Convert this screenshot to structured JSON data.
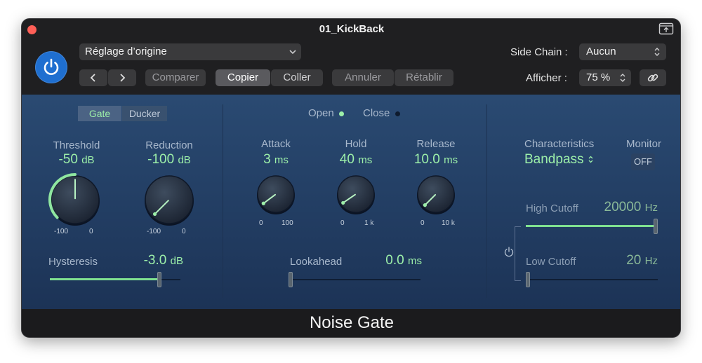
{
  "window": {
    "title": "01_KickBack"
  },
  "toolbar": {
    "preset": "Réglage d’origine",
    "compare": "Comparer",
    "copy": "Copier",
    "paste": "Coller",
    "undo": "Annuler",
    "redo": "Rétablir",
    "sidechain_label": "Side Chain :",
    "sidechain_value": "Aucun",
    "view_label": "Afficher :",
    "view_value": "75 %"
  },
  "gate_section": {
    "mode_gate": "Gate",
    "mode_ducker": "Ducker",
    "threshold": {
      "label": "Threshold",
      "value": "-50",
      "unit": "dB",
      "min": "-100",
      "max": "0",
      "level": 0.5
    },
    "reduction": {
      "label": "Reduction",
      "value": "-100",
      "unit": "dB",
      "min": "-100",
      "max": "0",
      "level": 0.0
    },
    "hysteresis": {
      "label": "Hysteresis",
      "value": "-3.0",
      "unit": "dB",
      "level": 0.85
    }
  },
  "envelope": {
    "open_label": "Open",
    "close_label": "Close",
    "attack": {
      "label": "Attack",
      "value": "3",
      "unit": "ms",
      "min": "0",
      "max": "100",
      "level": 0.03
    },
    "hold": {
      "label": "Hold",
      "value": "40",
      "unit": "ms",
      "min": "0",
      "max": "1 k",
      "level": 0.04
    },
    "release": {
      "label": "Release",
      "value": "10.0",
      "unit": "ms",
      "min": "0",
      "max": "10 k",
      "level": 0.0
    },
    "lookahead": {
      "label": "Lookahead",
      "value": "0.0",
      "unit": "ms",
      "level": 0.0
    }
  },
  "filter": {
    "characteristics_label": "Characteristics",
    "characteristics_value": "Bandpass",
    "monitor_label": "Monitor",
    "monitor_value": "OFF",
    "high_cutoff": {
      "label": "High Cutoff",
      "value": "20000",
      "unit": "Hz",
      "level": 1.0
    },
    "low_cutoff": {
      "label": "Low Cutoff",
      "value": "20",
      "unit": "Hz",
      "level": 0.0
    }
  },
  "footer": {
    "plugin_name": "Noise Gate"
  },
  "colors": {
    "accent_green": "#9cefa9",
    "power_blue": "#1f6fd0",
    "panel_top": "#2a4a72",
    "panel_bottom": "#1c3356"
  }
}
